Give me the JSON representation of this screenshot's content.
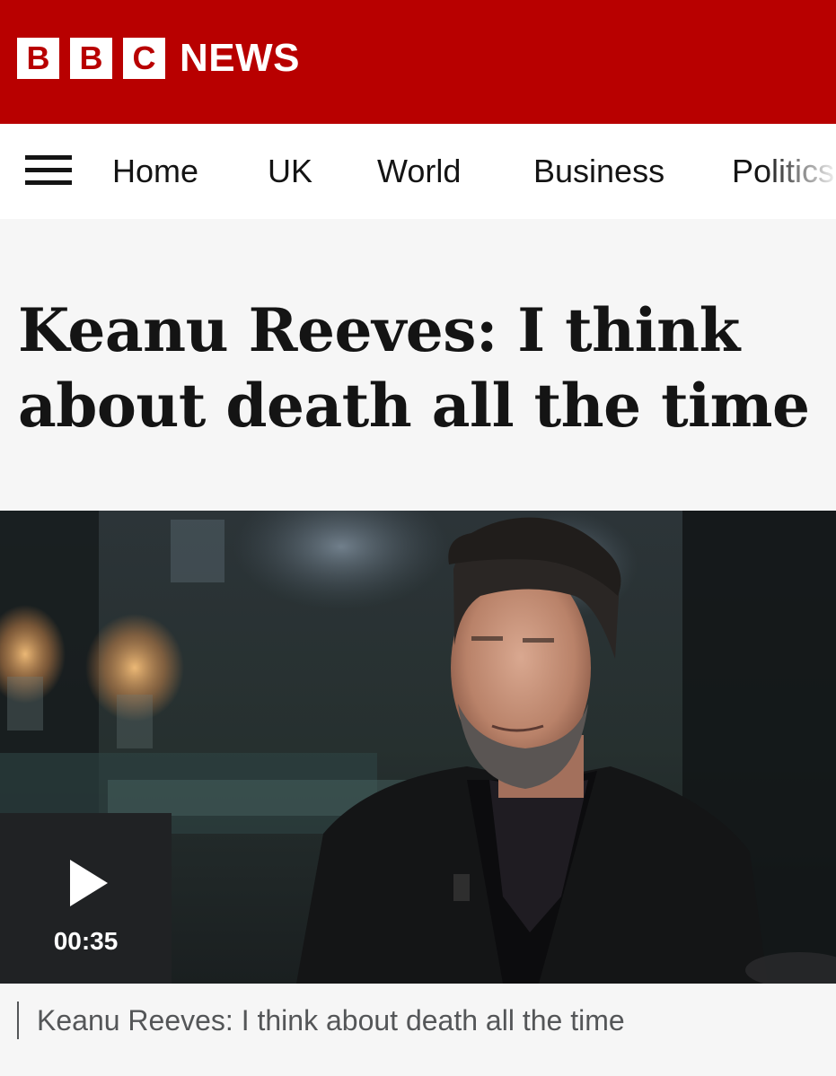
{
  "brand": {
    "logo_letters": [
      "B",
      "B",
      "C"
    ],
    "logo_suffix": "NEWS",
    "brand_color": "#b80000"
  },
  "nav": {
    "menu_icon": "hamburger-menu-icon",
    "items": [
      {
        "label": "Home"
      },
      {
        "label": "UK"
      },
      {
        "label": "World"
      },
      {
        "label": "Business"
      },
      {
        "label": "Politics"
      }
    ]
  },
  "article": {
    "headline": "Keanu Reeves: I think about death all the time"
  },
  "video": {
    "play_icon": "play-icon",
    "duration": "00:35",
    "caption": "Keanu Reeves: I think about death all the time"
  }
}
